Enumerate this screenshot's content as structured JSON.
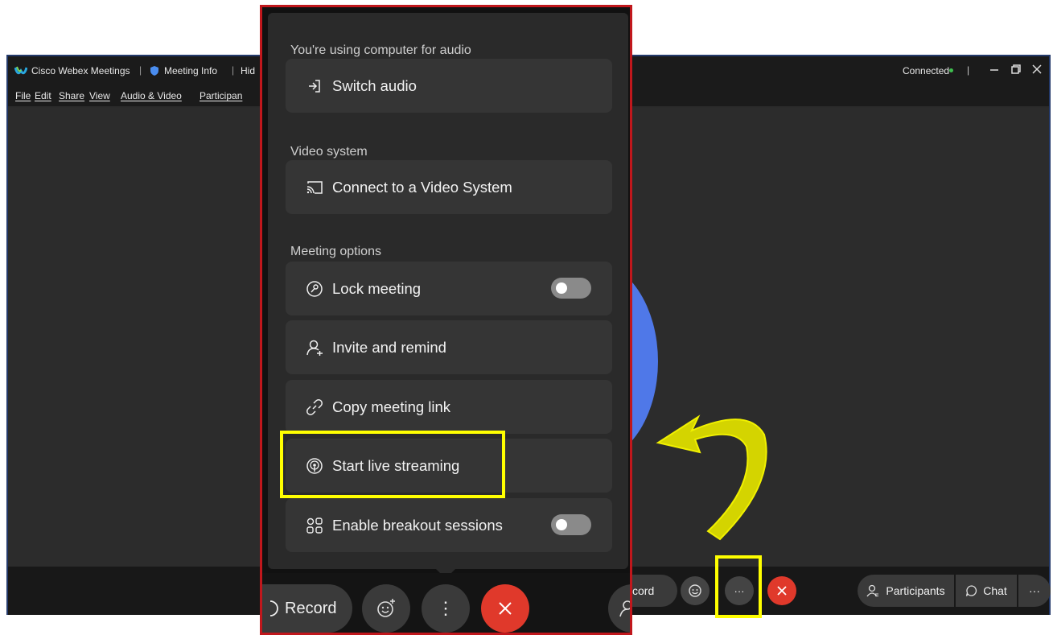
{
  "window": {
    "app_title": "Cisco Webex Meetings",
    "meeting_info": "Meeting Info",
    "hide_label": "Hid",
    "connection_status": "Connected",
    "menu": [
      "File",
      "Edit",
      "Share",
      "View",
      "Audio & Video",
      "Participan"
    ]
  },
  "bottom_bar": {
    "record_label": "cord",
    "participants_label": "Participants",
    "chat_label": "Chat",
    "more_label": "···"
  },
  "popup": {
    "audio_section": "You're using computer for audio",
    "switch_audio": "Switch audio",
    "video_section": "Video system",
    "connect_video": "Connect to a Video System",
    "meeting_options_section": "Meeting options",
    "lock_meeting": "Lock meeting",
    "lock_meeting_on": false,
    "invite_remind": "Invite and remind",
    "copy_link": "Copy meeting link",
    "live_streaming": "Start live streaming",
    "breakout": "Enable breakout sessions",
    "breakout_on": false
  },
  "zoom_bar": {
    "record_label": "Record",
    "more_label": "⋮"
  },
  "colors": {
    "highlight": "#ffff00",
    "end_call": "#e0392b",
    "zoom_border": "#c0171c",
    "window_border": "#243a6b",
    "arrow": "#d4d400",
    "status_dot": "#3fbf4f"
  }
}
